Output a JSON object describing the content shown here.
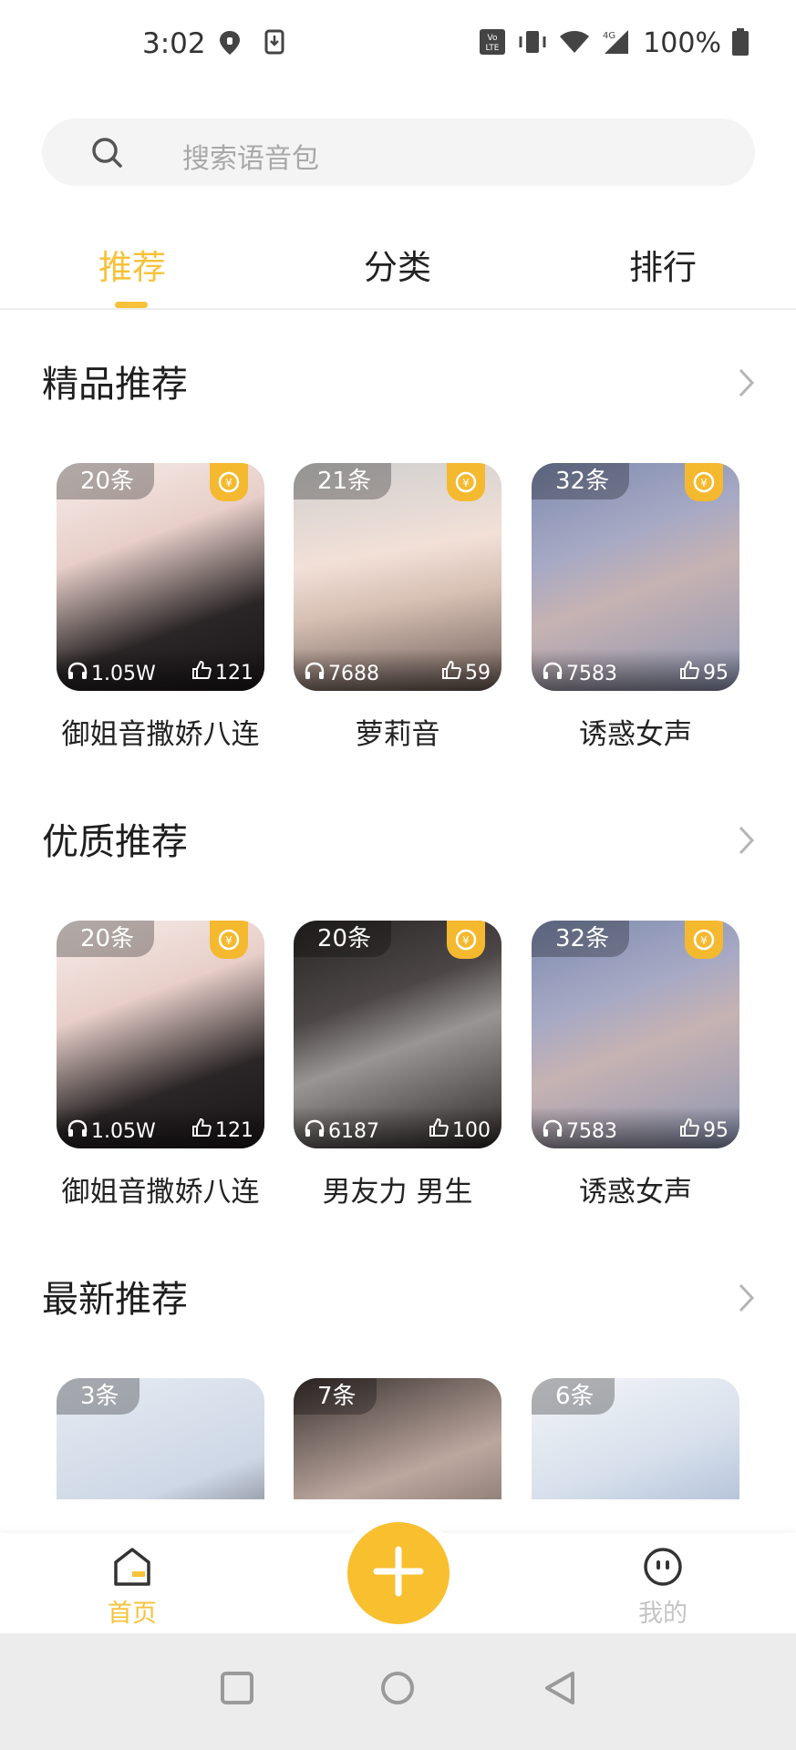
{
  "status": {
    "time": "3:02",
    "battery": "100%"
  },
  "search": {
    "placeholder": "搜索语音包"
  },
  "tabs": [
    {
      "label": "推荐",
      "active": true
    },
    {
      "label": "分类",
      "active": false
    },
    {
      "label": "排行",
      "active": false
    }
  ],
  "sections": [
    {
      "title": "精品推荐",
      "cards": [
        {
          "count": "20条",
          "plays": "1.05W",
          "likes": "121",
          "title": "御姐音撒娇八连"
        },
        {
          "count": "21条",
          "plays": "7688",
          "likes": "59",
          "title": "萝莉音"
        },
        {
          "count": "32条",
          "plays": "7583",
          "likes": "95",
          "title": "诱惑女声"
        }
      ]
    },
    {
      "title": "优质推荐",
      "cards": [
        {
          "count": "20条",
          "plays": "1.05W",
          "likes": "121",
          "title": "御姐音撒娇八连"
        },
        {
          "count": "20条",
          "plays": "6187",
          "likes": "100",
          "title": "男友力 男生"
        },
        {
          "count": "32条",
          "plays": "7583",
          "likes": "95",
          "title": "诱惑女声"
        }
      ]
    },
    {
      "title": "最新推荐",
      "cards": [
        {
          "count": "3条"
        },
        {
          "count": "7条"
        },
        {
          "count": "6条"
        }
      ]
    }
  ],
  "bottom_nav": {
    "home": "首页",
    "mine": "我的"
  },
  "colors": {
    "accent": "#F7C23A",
    "coin": "#F4B92F"
  }
}
